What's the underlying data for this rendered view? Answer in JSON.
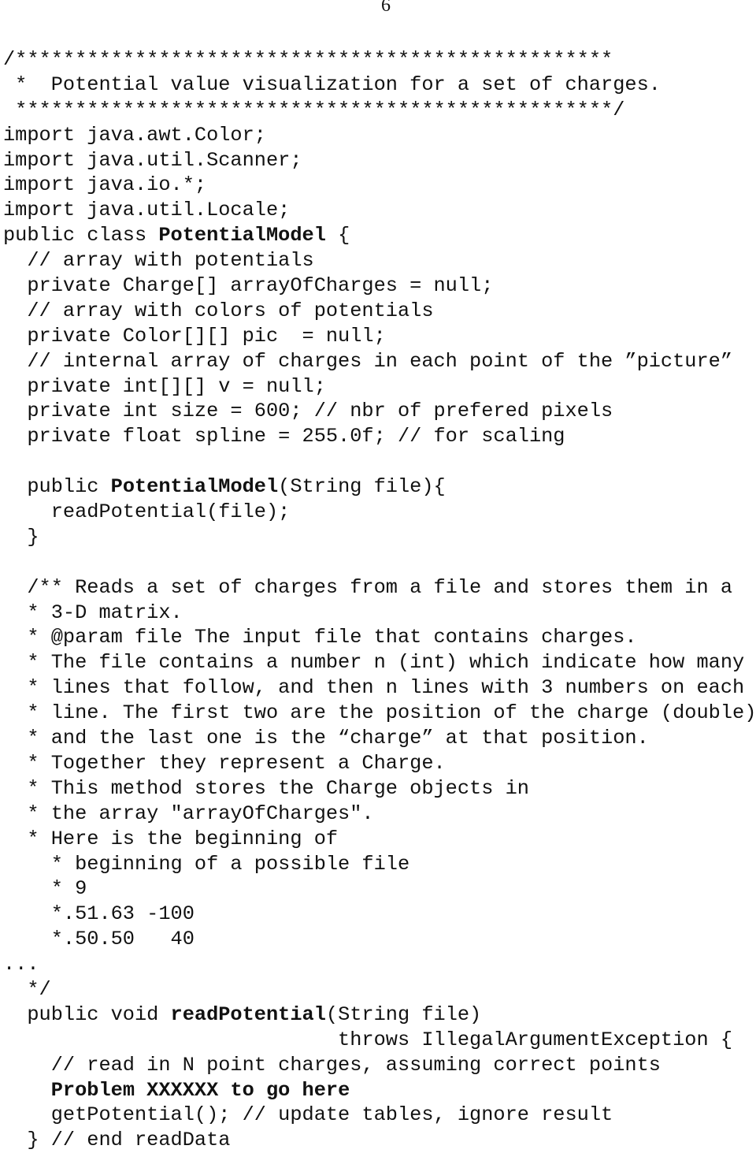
{
  "page_number": "6",
  "code_lines": [
    {
      "segments": [
        {
          "text": "/**************************************************"
        }
      ]
    },
    {
      "segments": [
        {
          "text": " *  Potential value visualization for a set of charges."
        }
      ]
    },
    {
      "segments": [
        {
          "text": " **************************************************/"
        }
      ]
    },
    {
      "segments": [
        {
          "text": "import java.awt.Color;"
        }
      ]
    },
    {
      "segments": [
        {
          "text": "import java.util.Scanner;"
        }
      ]
    },
    {
      "segments": [
        {
          "text": "import java.io.*;"
        }
      ]
    },
    {
      "segments": [
        {
          "text": "import java.util.Locale;"
        }
      ]
    },
    {
      "segments": [
        {
          "text": "public class "
        },
        {
          "text": "PotentialModel",
          "bold": true
        },
        {
          "text": " {"
        }
      ]
    },
    {
      "segments": [
        {
          "text": "  // array with potentials"
        }
      ]
    },
    {
      "segments": [
        {
          "text": "  private Charge[] arrayOfCharges = null;"
        }
      ]
    },
    {
      "segments": [
        {
          "text": "  // array with colors of potentials"
        }
      ]
    },
    {
      "segments": [
        {
          "text": "  private Color[][] pic  = null;"
        }
      ]
    },
    {
      "segments": [
        {
          "text": "  // internal array of charges in each point of the ”picture”"
        }
      ]
    },
    {
      "segments": [
        {
          "text": "  private int[][] v = null;"
        }
      ]
    },
    {
      "segments": [
        {
          "text": "  private int size = 600; // nbr of prefered pixels"
        }
      ]
    },
    {
      "segments": [
        {
          "text": "  private float spline = 255.0f; // for scaling"
        }
      ]
    },
    {
      "segments": [
        {
          "text": ""
        }
      ]
    },
    {
      "segments": [
        {
          "text": "  public "
        },
        {
          "text": "PotentialModel",
          "bold": true
        },
        {
          "text": "(String file){"
        }
      ]
    },
    {
      "segments": [
        {
          "text": "    readPotential(file);"
        }
      ]
    },
    {
      "segments": [
        {
          "text": "  }"
        }
      ]
    },
    {
      "segments": [
        {
          "text": ""
        }
      ]
    },
    {
      "segments": [
        {
          "text": "  /** Reads a set of charges from a file and stores them in a"
        }
      ]
    },
    {
      "segments": [
        {
          "text": "  * 3-D matrix."
        }
      ]
    },
    {
      "segments": [
        {
          "text": "  * @param file The input file that contains charges."
        }
      ]
    },
    {
      "segments": [
        {
          "text": "  * The file contains a number n (int) which indicate how many"
        }
      ]
    },
    {
      "segments": [
        {
          "text": "  * lines that follow, and then n lines with 3 numbers on each"
        }
      ]
    },
    {
      "segments": [
        {
          "text": "  * line. The first two are the position of the charge (double)"
        }
      ]
    },
    {
      "segments": [
        {
          "text": "  * and the last one is the “charge” at that position."
        }
      ]
    },
    {
      "segments": [
        {
          "text": "  * Together they represent a Charge."
        }
      ]
    },
    {
      "segments": [
        {
          "text": "  * This method stores the Charge objects in"
        }
      ]
    },
    {
      "segments": [
        {
          "text": "  * the array \"arrayOfCharges\"."
        }
      ]
    },
    {
      "segments": [
        {
          "text": "  * Here is the beginning of"
        }
      ]
    },
    {
      "segments": [
        {
          "text": "    * beginning of a possible file"
        }
      ]
    },
    {
      "segments": [
        {
          "text": "    * 9"
        }
      ]
    },
    {
      "segments": [
        {
          "text": "    *.51.63 -100"
        }
      ]
    },
    {
      "segments": [
        {
          "text": "    *.50.50   40"
        }
      ]
    },
    {
      "segments": [
        {
          "text": "..."
        }
      ]
    },
    {
      "segments": [
        {
          "text": "  */"
        }
      ]
    },
    {
      "segments": [
        {
          "text": "  public void "
        },
        {
          "text": "readPotential",
          "bold": true
        },
        {
          "text": "(String file)"
        }
      ]
    },
    {
      "segments": [
        {
          "text": "                            throws IllegalArgumentException {"
        }
      ]
    },
    {
      "segments": [
        {
          "text": "    // read in N point charges, assuming correct points"
        }
      ]
    },
    {
      "segments": [
        {
          "text": "    "
        },
        {
          "text": "Problem XXXXXX to go here",
          "bold": true
        }
      ]
    },
    {
      "segments": [
        {
          "text": "    getPotential(); // update tables, ignore result"
        }
      ]
    },
    {
      "segments": [
        {
          "text": "  } // end readData"
        }
      ]
    }
  ]
}
